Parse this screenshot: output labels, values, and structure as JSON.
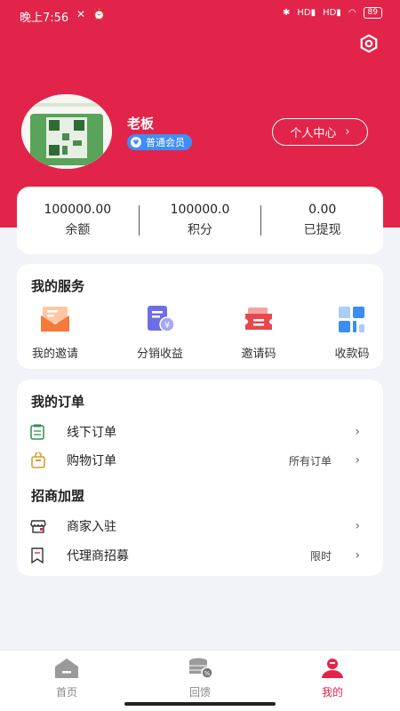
{
  "status_bar": {
    "time": "晚上7:56",
    "battery": "89"
  },
  "profile": {
    "name": "老板",
    "member_level": "普通会员",
    "center_button": "个人中心"
  },
  "stats": [
    {
      "value": "100000.00",
      "label": "余额"
    },
    {
      "value": "100000.0",
      "label": "积分"
    },
    {
      "value": "0.00",
      "label": "已提现"
    }
  ],
  "services": {
    "title": "我的服务",
    "items": [
      {
        "label": "我的邀请",
        "icon": "invite-mail-icon"
      },
      {
        "label": "分销收益",
        "icon": "revenue-doc-icon"
      },
      {
        "label": "邀请码",
        "icon": "ticket-icon"
      },
      {
        "label": "收款码",
        "icon": "grid-qr-icon"
      }
    ]
  },
  "orders": {
    "title": "我的订单",
    "rows": [
      {
        "label": "线下订单",
        "extra": "",
        "icon": "clipboard-icon"
      },
      {
        "label": "购物订单",
        "extra": "所有订单",
        "icon": "shopping-bag-icon"
      }
    ]
  },
  "franchise": {
    "title": "招商加盟",
    "rows": [
      {
        "label": "商家入驻",
        "extra": "",
        "icon": "store-icon"
      },
      {
        "label": "代理商招募",
        "extra": "限时",
        "icon": "bookmark-icon"
      }
    ]
  },
  "nav": [
    {
      "label": "首页",
      "icon": "home-icon"
    },
    {
      "label": "回馈",
      "icon": "coins-icon"
    },
    {
      "label": "我的",
      "icon": "person-icon"
    }
  ],
  "colors": {
    "brand": "#e3244a",
    "badge": "#3f8ef7",
    "background": "#f1f3f8"
  }
}
